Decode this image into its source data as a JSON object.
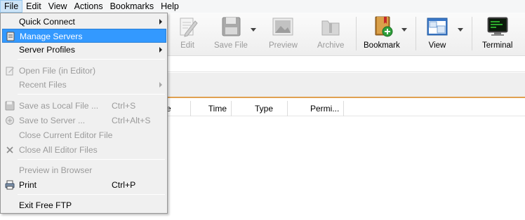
{
  "menubar": {
    "items": [
      {
        "label": "File"
      },
      {
        "label": "Edit"
      },
      {
        "label": "View"
      },
      {
        "label": "Actions"
      },
      {
        "label": "Bookmarks"
      },
      {
        "label": "Help"
      }
    ]
  },
  "toolbar": {
    "edit": "Edit",
    "save_file": "Save File",
    "preview": "Preview",
    "archive": "Archive",
    "bookmark": "Bookmark",
    "view": "View",
    "terminal": "Terminal"
  },
  "columns": {
    "partial": "e",
    "time": "Time",
    "type": "Type",
    "permissions": "Permi..."
  },
  "file_menu": {
    "quick_connect": "Quick Connect",
    "manage_servers": "Manage Servers",
    "server_profiles": "Server Profiles",
    "open_file": "Open File (in Editor)",
    "recent_files": "Recent Files",
    "save_local": "Save as Local File ...",
    "save_local_sc": "Ctrl+S",
    "save_server": "Save to Server ...",
    "save_server_sc": "Ctrl+Alt+S",
    "close_current": "Close Current Editor File",
    "close_all": "Close All Editor Files",
    "preview_browser": "Preview in Browser",
    "print": "Print",
    "print_sc": "Ctrl+P",
    "exit": "Exit Free FTP"
  },
  "colors": {
    "highlight": "#3399ff",
    "accent_border": "#e0a050",
    "disabled_text": "#9b9b9b"
  }
}
